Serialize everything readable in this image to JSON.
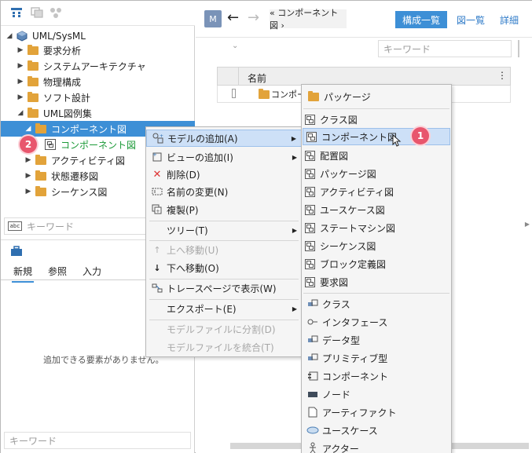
{
  "left_panel": {
    "tree": [
      {
        "label": "UML/SysML"
      },
      {
        "label": "要求分析"
      },
      {
        "label": "システムアーキテクチャ"
      },
      {
        "label": "物理構成"
      },
      {
        "label": "ソフト設計"
      },
      {
        "label": "UML図例集"
      },
      {
        "label": "コンポーネント図"
      },
      {
        "label": "コンポーネント図"
      },
      {
        "label": "アクティビティ図"
      },
      {
        "label": "状態遷移図"
      },
      {
        "label": "シーケンス図"
      }
    ],
    "search_placeholder": "キーワード",
    "tabs": [
      "新規",
      "参照",
      "入力"
    ],
    "empty_message": "追加できる要素がありません。",
    "bottom_search_placeholder": "キーワード"
  },
  "right_panel": {
    "m_badge": "M",
    "back_arrow": "←",
    "forward_arrow": "→",
    "breadcrumb": "« コンポーネント図 ›",
    "tabs": {
      "active": "構成一覧",
      "diagrams": "図一覧",
      "details": "詳細"
    },
    "keyword_placeholder": "キーワード",
    "column_name": "名前",
    "row_label": "コンポー"
  },
  "context_menu": {
    "items": [
      {
        "label": "モデルの追加(A)",
        "icon": "add-model-icon"
      },
      {
        "label": "ビューの追加(I)",
        "icon": "add-view-icon"
      },
      {
        "label": "削除(D)",
        "icon": "delete-icon"
      },
      {
        "label": "名前の変更(N)",
        "icon": "rename-icon"
      },
      {
        "label": "複製(P)",
        "icon": "duplicate-icon"
      },
      {
        "label": "ツリー(T)"
      },
      {
        "label": "上へ移動(U)",
        "icon": "up-arrow-icon"
      },
      {
        "label": "下へ移動(O)",
        "icon": "down-arrow-icon"
      },
      {
        "label": "トレースページで表示(W)",
        "icon": "trace-icon"
      },
      {
        "label": "エクスポート(E)"
      },
      {
        "label": "モデルファイルに分割(D)"
      },
      {
        "label": "モデルファイルを統合(T)"
      }
    ]
  },
  "submenu": {
    "items": [
      "パッケージ",
      "クラス図",
      "コンポーネント図",
      "配置図",
      "パッケージ図",
      "アクティビティ図",
      "ユースケース図",
      "ステートマシン図",
      "シーケンス図",
      "ブロック定義図",
      "要求図",
      "クラス",
      "インタフェース",
      "データ型",
      "プリミティブ型",
      "コンポーネント",
      "ノード",
      "アーティファクト",
      "ユースケース",
      "アクター"
    ]
  },
  "badges": {
    "one": "1",
    "two": "2"
  },
  "colors": {
    "selection": "#3d8fd6",
    "badge": "#e8566d",
    "folder": "#e2a33a",
    "green_text": "#1c9a38"
  }
}
